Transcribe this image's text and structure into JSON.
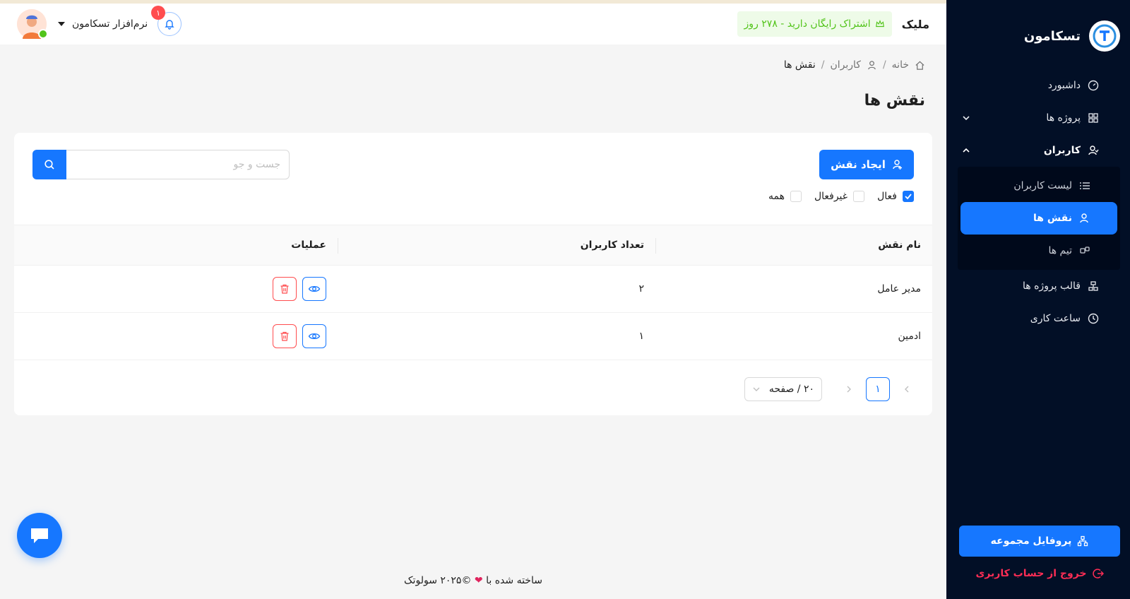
{
  "sidebar": {
    "brand_name": "تسکامون",
    "nav": {
      "dashboard": "داشبورد",
      "projects": "پروژه ها",
      "users": "کاربران",
      "users_list": "لیست کاربران",
      "roles": "نقش ها",
      "teams": "تیم ها",
      "project_templates": "قالب پروژه ها",
      "work_hours": "ساعت کاری"
    },
    "profile_button": "پروفایل مجموعه",
    "logout": "خروج از حساب کاربری"
  },
  "header": {
    "title": "ملیک",
    "subscription": "اشتراک رایگان دارید - ۲۷۸ روز",
    "user_name": "نرم‌افزار تسکامون",
    "notification_count": "۱"
  },
  "breadcrumb": {
    "home": "خانه",
    "users": "کاربران",
    "current": "نقش ها",
    "sep": "/"
  },
  "page_title": "نقش ها",
  "toolbar": {
    "create_label": "ایجاد نقش",
    "search_placeholder": "جست و جو",
    "filters": {
      "active": "فعال",
      "inactive": "غیرفعال",
      "all": "همه"
    }
  },
  "table": {
    "headers": {
      "name": "نام نقش",
      "count": "تعداد کاربران",
      "actions": "عملیات"
    },
    "rows": [
      {
        "name": "مدیر عامل",
        "count": "۲"
      },
      {
        "name": "ادمین",
        "count": "۱"
      }
    ]
  },
  "pagination": {
    "current_page": "۱",
    "page_size": "۲۰ / صفحه"
  },
  "footer": {
    "before": "ساخته شده با",
    "after": "©۲۰۲۵ سولوتک"
  },
  "colors": {
    "primary": "#1677ff",
    "sidebar_bg": "#020f26",
    "danger": "#ff4d4f",
    "success": "#52c41a"
  }
}
